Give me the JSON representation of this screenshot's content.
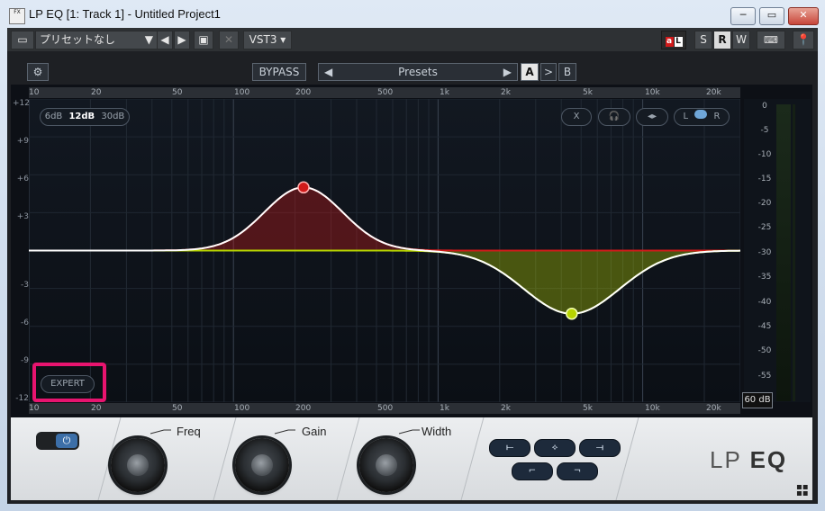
{
  "window": {
    "title": "LP EQ [1: Track 1] - Untitled Project1",
    "icon_text": "FX",
    "buttons": [
      "─",
      "▭",
      "✕"
    ]
  },
  "toolbar": {
    "preset_name": "プリセットなし",
    "format": "VST3 ▾",
    "prev": "◀",
    "next": "▶",
    "save": "▣",
    "close": "✕",
    "monitor_buttons": [
      {
        "label": "L",
        "active": false
      },
      {
        "label": "S",
        "active": false
      },
      {
        "label": "R",
        "active": true
      },
      {
        "label": "W",
        "active": false
      }
    ]
  },
  "plugin": {
    "settings_icon": "gear-icon",
    "bypass_label": "BYPASS",
    "presets_label": "Presets",
    "ab": {
      "a": "A",
      "arrow": ">",
      "b": "B"
    },
    "range_options": [
      "6dB",
      "12dB",
      "30dB"
    ],
    "range_selected": "12dB",
    "graph_controls": {
      "x": "X",
      "headphones": "headphones-icon",
      "lr": "L",
      "r": "R"
    },
    "expert_label": "EXPERT",
    "meter_range": "60 dB"
  },
  "graph": {
    "freq_labels": [
      "10",
      "20",
      "50",
      "100",
      "200",
      "500",
      "1k",
      "2k",
      "5k",
      "10k",
      "20k"
    ],
    "db_labels": [
      "+12",
      "+9",
      "+6",
      "+3",
      "-3",
      "-6",
      "-9",
      "-12"
    ],
    "meter_labels": [
      "0",
      "-5",
      "-10",
      "-15",
      "-20",
      "-25",
      "-30",
      "-35",
      "-40",
      "-45",
      "-50",
      "-55"
    ],
    "colors": {
      "band1": "#d11a1a",
      "band2": "#b7d400",
      "curve": "#ffffff"
    },
    "bands": [
      {
        "name": "band1",
        "freq_hz": 220,
        "gain_db": 5.0
      },
      {
        "name": "band2",
        "freq_hz": 4500,
        "gain_db": -5.0
      }
    ]
  },
  "controls": {
    "freq_label": "Freq",
    "gain_label": "Gain",
    "width_label": "Width",
    "logo_lp": "LP",
    "logo_eq": "EQ"
  }
}
